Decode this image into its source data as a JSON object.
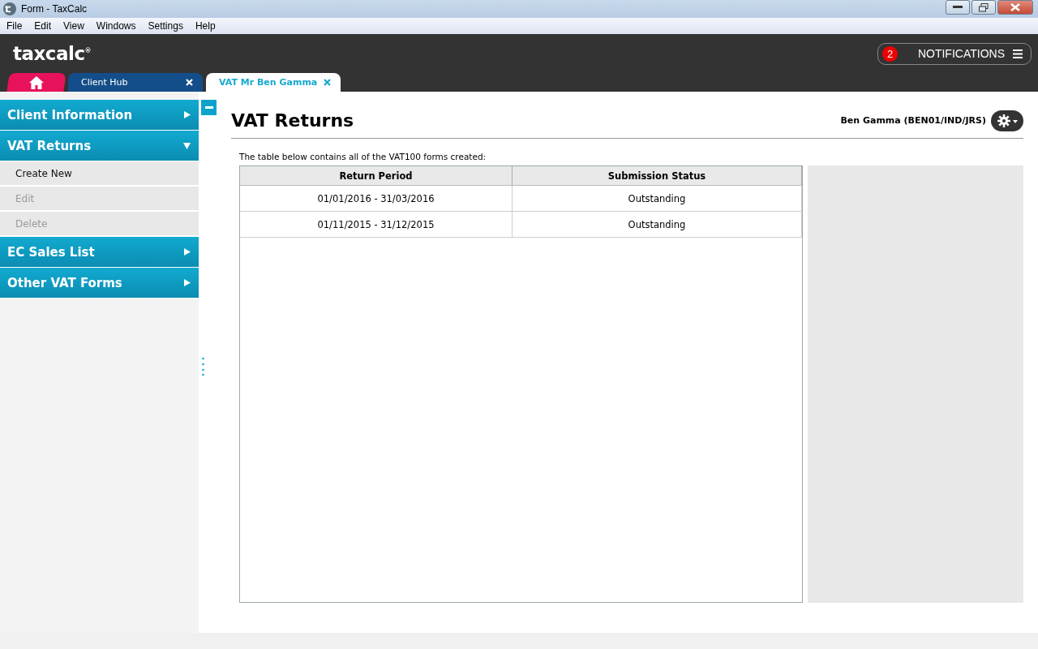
{
  "window": {
    "title": "Form - TaxCalc"
  },
  "menu": [
    "File",
    "Edit",
    "View",
    "Windows",
    "Settings",
    "Help"
  ],
  "header": {
    "logo": "taxcalc",
    "logo_mark": "®",
    "notifications": {
      "count": "2",
      "label": "NOTIFICATIONS"
    }
  },
  "tabs": [
    {
      "kind": "home",
      "selected": false
    },
    {
      "kind": "page",
      "label": "Client Hub",
      "selected": false
    },
    {
      "kind": "page",
      "label": "VAT Mr Ben Gamma",
      "selected": true
    }
  ],
  "sidebar": [
    {
      "label": "Client Information",
      "expanded": false
    },
    {
      "label": "VAT Returns",
      "expanded": true,
      "children": [
        {
          "label": "Create New",
          "disabled": false
        },
        {
          "label": "Edit",
          "disabled": true
        },
        {
          "label": "Delete",
          "disabled": true
        }
      ]
    },
    {
      "label": "EC Sales List",
      "expanded": false
    },
    {
      "label": "Other VAT Forms",
      "expanded": false
    }
  ],
  "page": {
    "title": "VAT Returns",
    "client": "Ben Gamma (BEN01/IND/JRS)",
    "intro": "The table below contains all of the VAT100 forms created:"
  },
  "table": {
    "columns": [
      "Return Period",
      "Submission Status"
    ],
    "rows": [
      [
        "01/01/2016 - 31/03/2016",
        "Outstanding"
      ],
      [
        "01/11/2015 - 31/12/2015",
        "Outstanding"
      ]
    ]
  }
}
